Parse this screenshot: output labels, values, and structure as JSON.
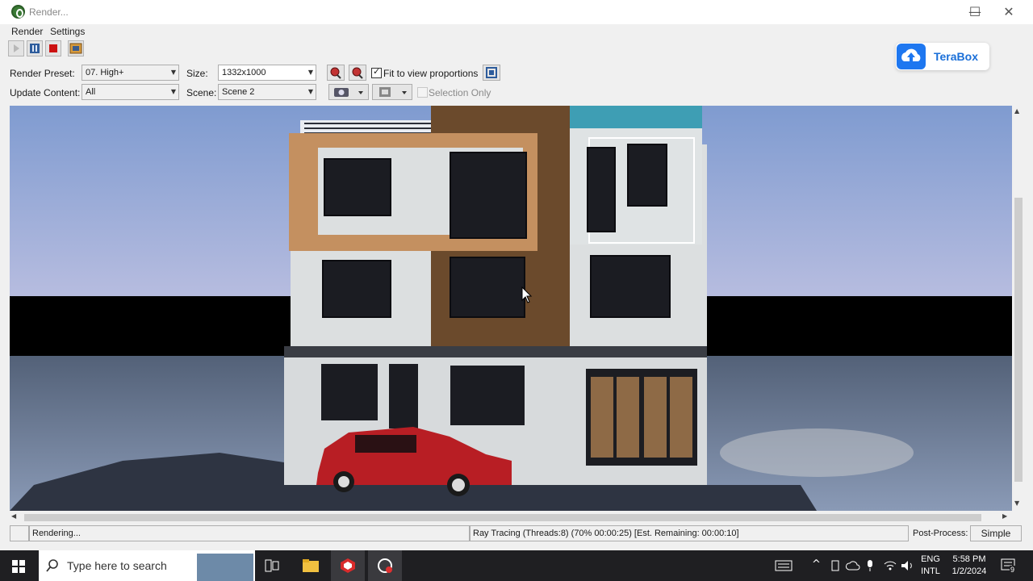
{
  "window": {
    "title": "Render...",
    "min_glyph": "—",
    "max_glyph": "☐",
    "close_glyph": "✕"
  },
  "menu": {
    "items": [
      "Render",
      "Settings"
    ]
  },
  "toolbar": {
    "icons": [
      "play-icon",
      "pause-icon",
      "stop-icon",
      "save-image-icon"
    ]
  },
  "controls": {
    "render_preset_label": "Render Preset:",
    "render_preset_value": "07. High+",
    "size_label": "Size:",
    "size_value": "1332x1000",
    "fit_label": "Fit to view proportions",
    "fit_checked": true,
    "update_content_label": "Update Content:",
    "update_content_value": "All",
    "scene_label": "Scene:",
    "scene_value": "Scene 2",
    "selection_only_label": "Selection Only",
    "selection_only_checked": false
  },
  "overlay": {
    "brand": "TeraBox"
  },
  "status": {
    "left": "Rendering...",
    "progress": "Ray Tracing (Threads:8) (70% 00:00:25) [Est. Remaining: 00:00:10]",
    "post_process_label": "Post-Process:",
    "post_process_value": "Simple"
  },
  "taskbar": {
    "search_placeholder": "Type here to search",
    "lang_top": "ENG",
    "lang_bottom": "INTL",
    "time": "5:58 PM",
    "date": "1/2/2024",
    "notification_count": "9"
  },
  "colors": {
    "accent": "#1e77f0",
    "stop_red": "#cc1111",
    "car_red": "#b81e24",
    "wood": "#6b4a2c",
    "frame_tan": "#c49060"
  }
}
